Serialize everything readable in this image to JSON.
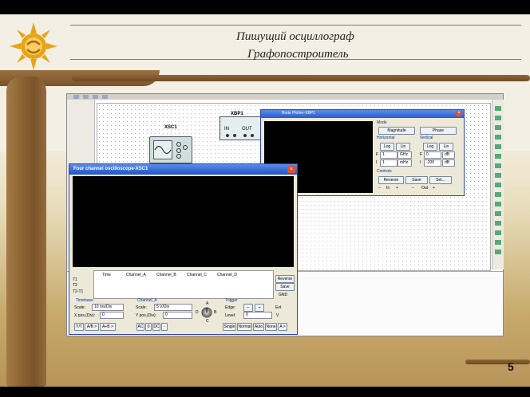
{
  "slide": {
    "title_line1": "Пишущий осциллограф",
    "title_line2": "Графопостроитель",
    "page_number": "5"
  },
  "canvas": {
    "xsc1_label": "XSC1",
    "xbp1_label": "XBP1",
    "xbp_in": "IN",
    "xbp_out": "OUT"
  },
  "bode_plotter": {
    "title": "Bode Plotter-XBP1",
    "mode_label": "Mode",
    "magnitude": "Magnitude",
    "phase": "Phase",
    "horizontal_label": "Horizontal",
    "vertical_label": "Vertical",
    "h_log": "Log",
    "h_lin": "Lin",
    "v_log": "Log",
    "v_lin": "Lin",
    "h_F_label": "F",
    "h_F_value": "1",
    "h_F_unit": "GHz",
    "h_I_label": "I",
    "h_I_value": "1",
    "h_I_unit": "mHz",
    "v_F_label": "F",
    "v_F_value": "0",
    "v_F_unit": "dB",
    "v_I_label": "I",
    "v_I_value": "-200",
    "v_I_unit": "dB",
    "controls_label": "Controls",
    "reverse": "Reverse",
    "save": "Save",
    "set": "Set...",
    "in_minus": "−",
    "in_label": "In",
    "in_plus": "+",
    "out_minus": "−",
    "out_label": "Out",
    "out_plus": "+"
  },
  "oscilloscope": {
    "title": "Four channel oscilloscope-XSC1",
    "t1": "T1",
    "t2": "T2",
    "t2t1": "T2-T1",
    "col_time": "Time",
    "col_a": "Channel_A",
    "col_b": "Channel_B",
    "col_c": "Channel_C",
    "col_d": "Channel_D",
    "reverse": "Reverse",
    "save": "Save",
    "gnd": "GND",
    "timebase_label": "Timebase",
    "scale_label": "Scale:",
    "scale_value": "10 ms/Div",
    "xpos_label": "X pos.(Div):",
    "xpos_value": "0",
    "ya_btn": "Y/T",
    "add_btn": "A/B >",
    "ab_btn": "A+B >",
    "channel_a_label": "Channel_A",
    "ch_scale_label": "Scale:",
    "ch_scale_value": "5 V/Div",
    "ypos_label": "Y pos.(Div):",
    "ypos_value": "0",
    "ac": "AC",
    "zero": "0",
    "dc": "DC",
    "minus": "-",
    "knob_a": "A",
    "knob_b": "B",
    "knob_c": "C",
    "knob_d": "D",
    "trigger_label": "Trigger",
    "edge_label": "Edge:",
    "ext_label": "Ext",
    "level_label": "Level:",
    "level_value": "0",
    "level_unit": "V",
    "single": "Single",
    "normal": "Normal",
    "auto": "Auto",
    "none": "None",
    "a_btn": "A >"
  },
  "colors": {
    "title_bar": "#2a5ad0",
    "scope_bg": "#000000",
    "background_sand": "#c6a96a",
    "wood": "#8f6535"
  },
  "icons": [
    "sun-logo-icon",
    "close-icon",
    "knob-icon",
    "oscilloscope-icon",
    "bode-plotter-icon"
  ]
}
